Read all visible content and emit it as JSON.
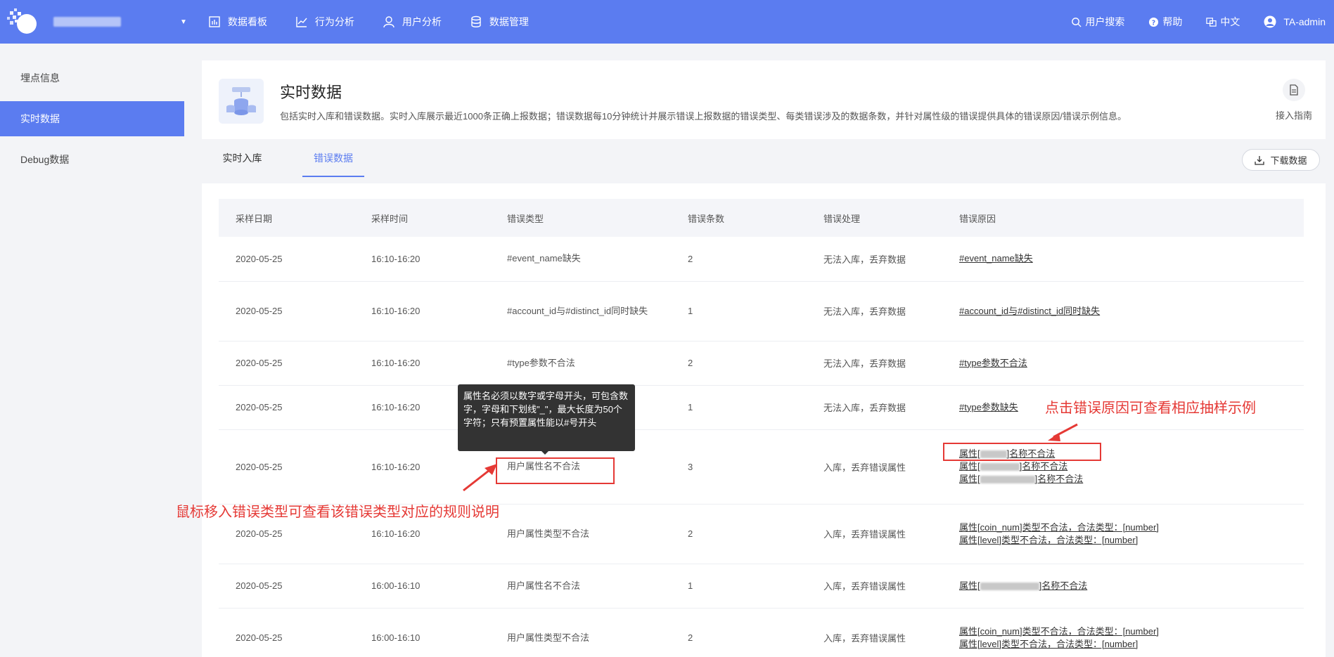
{
  "topbar": {
    "nav": [
      {
        "label": "数据看板",
        "icon": "dashboard-icon"
      },
      {
        "label": "行为分析",
        "icon": "trend-icon"
      },
      {
        "label": "用户分析",
        "icon": "user-icon"
      },
      {
        "label": "数据管理",
        "icon": "database-icon"
      }
    ],
    "search_label": "用户搜索",
    "help_label": "帮助",
    "lang_label": "中文",
    "user_label": "TA-admin"
  },
  "sidebar": {
    "items": [
      {
        "label": "埋点信息"
      },
      {
        "label": "实时数据"
      },
      {
        "label": "Debug数据"
      }
    ]
  },
  "header": {
    "title": "实时数据",
    "desc": "包括实时入库和错误数据。实时入库展示最近1000条正确上报数据；错误数据每10分钟统计并展示错误上报数据的错误类型、每类错误涉及的数据条数，并针对属性级的错误提供具体的错误原因/错误示例信息。",
    "guide_label": "接入指南"
  },
  "tabs": [
    {
      "label": "实时入库"
    },
    {
      "label": "错误数据"
    }
  ],
  "download_label": "下载数据",
  "table": {
    "headers": [
      "采样日期",
      "采样时间",
      "错误类型",
      "错误条数",
      "错误处理",
      "错误原因"
    ],
    "rows": [
      {
        "date": "2020-05-25",
        "time": "16:10-16:20",
        "type": "#event_name缺失",
        "count": "2",
        "handling": "无法入库，丢弃数据",
        "reasons": [
          "#event_name缺失"
        ]
      },
      {
        "date": "2020-05-25",
        "time": "16:10-16:20",
        "type": "#account_id与#distinct_id同时缺失",
        "count": "1",
        "handling": "无法入库，丢弃数据",
        "reasons": [
          "#account_id与#distinct_id同时缺失"
        ]
      },
      {
        "date": "2020-05-25",
        "time": "16:10-16:20",
        "type": "#type参数不合法",
        "count": "2",
        "handling": "无法入库，丢弃数据",
        "reasons": [
          "#type参数不合法"
        ]
      },
      {
        "date": "2020-05-25",
        "time": "16:10-16:20",
        "type": "",
        "count": "1",
        "handling": "无法入库，丢弃数据",
        "reasons": [
          "#type参数缺失"
        ]
      },
      {
        "date": "2020-05-25",
        "time": "16:10-16:20",
        "type": "用户属性名不合法",
        "count": "3",
        "handling": "入库，丢弃错误属性",
        "reasons_blurred": [
          {
            "prefix": "属性[",
            "suffix": "]名称不合法"
          },
          {
            "prefix": "属性[",
            "suffix": "]名称不合法"
          },
          {
            "prefix": "属性[",
            "suffix": "]名称不合法"
          }
        ]
      },
      {
        "date": "2020-05-25",
        "time": "16:10-16:20",
        "type": "用户属性类型不合法",
        "count": "2",
        "handling": "入库，丢弃错误属性",
        "reasons": [
          "属性[coin_num]类型不合法，合法类型：[number]",
          "属性[level]类型不合法，合法类型：[number]"
        ]
      },
      {
        "date": "2020-05-25",
        "time": "16:00-16:10",
        "type": "用户属性名不合法",
        "count": "1",
        "handling": "入库，丢弃错误属性",
        "reasons_blurred": [
          {
            "prefix": "属性[",
            "suffix": "]名称不合法"
          }
        ]
      },
      {
        "date": "2020-05-25",
        "time": "16:00-16:10",
        "type": "用户属性类型不合法",
        "count": "2",
        "handling": "入库，丢弃错误属性",
        "reasons": [
          "属性[coin_num]类型不合法，合法类型：[number]",
          "属性[level]类型不合法，合法类型：[number]"
        ]
      }
    ]
  },
  "tooltip": "属性名必须以数字或字母开头，可包含数字，字母和下划线\"_\"，最大长度为50个字符；只有预置属性能以#号开头",
  "annotations": {
    "right": "点击错误原因可查看相应抽样示例",
    "left": "鼠标移入错误类型可查看该错误类型对应的规则说明"
  },
  "colors": {
    "primary": "#5b7cf0",
    "annotation": "#e53935",
    "tooltip_bg": "#333333"
  }
}
